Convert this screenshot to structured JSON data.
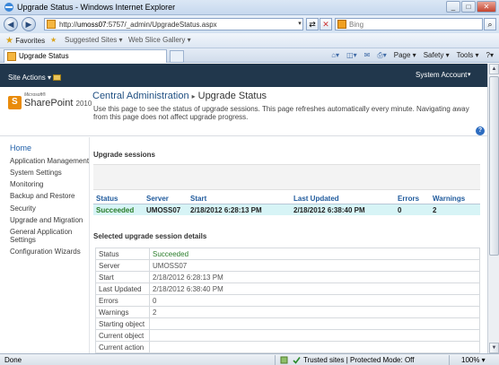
{
  "window": {
    "title": "Upgrade Status - Windows Internet Explorer",
    "minimize": "_",
    "maximize": "□",
    "close": "✕"
  },
  "addressbar": {
    "url_prefix": "http://",
    "url_host": "umoss07",
    "url_rest": ":5757/_admin/UpgradeStatus.aspx",
    "search_placeholder": "Bing"
  },
  "favorites": {
    "favorites_label": "Favorites",
    "suggested_sites": "Suggested Sites ▾",
    "web_slice_gallery": "Web Slice Gallery ▾"
  },
  "tab": {
    "label": "Upgrade Status"
  },
  "commandbar": {
    "page": "Page ▾",
    "safety": "Safety ▾",
    "tools": "Tools ▾",
    "help": "?▾"
  },
  "sharepoint": {
    "site_actions": "Site Actions ▾",
    "system_account": "System Account",
    "logo_ms": "Microsoft®",
    "logo_word": "SharePoint",
    "logo_year": "2010",
    "breadcrumb_root": "Central Administration",
    "breadcrumb_sep": "▸",
    "breadcrumb_current": "Upgrade Status",
    "page_description": "Use this page to see the status of upgrade sessions. This page refreshes automatically every minute. Navigating away from this page does not affect upgrade progress."
  },
  "leftnav": {
    "items": [
      {
        "label": "Home"
      },
      {
        "label": "Application Management"
      },
      {
        "label": "System Settings"
      },
      {
        "label": "Monitoring"
      },
      {
        "label": "Backup and Restore"
      },
      {
        "label": "Security"
      },
      {
        "label": "Upgrade and Migration"
      },
      {
        "label": "General Application Settings"
      },
      {
        "label": "Configuration Wizards"
      }
    ]
  },
  "sessions": {
    "heading": "Upgrade sessions",
    "columns": [
      "Status",
      "Server",
      "Start",
      "Last Updated",
      "Errors",
      "Warnings"
    ],
    "rows": [
      {
        "status": "Succeeded",
        "server": "UMOSS07",
        "start": "2/18/2012 6:28:13 PM",
        "last_updated": "2/18/2012 6:38:40 PM",
        "errors": "0",
        "warnings": "2"
      }
    ]
  },
  "details": {
    "heading": "Selected upgrade session details",
    "rows": [
      {
        "key": "Status",
        "value": "Succeeded"
      },
      {
        "key": "Server",
        "value": "UMOSS07"
      },
      {
        "key": "Start",
        "value": "2/18/2012 6:28:13 PM"
      },
      {
        "key": "Last Updated",
        "value": "2/18/2012 6:38:40 PM"
      },
      {
        "key": "Errors",
        "value": "0"
      },
      {
        "key": "Warnings",
        "value": "2"
      },
      {
        "key": "Starting object",
        "value": ""
      },
      {
        "key": "Current object",
        "value": ""
      },
      {
        "key": "Current action",
        "value": ""
      }
    ]
  },
  "statusbar": {
    "done": "Done",
    "zone": "Trusted sites | Protected Mode: Off",
    "zoom": "100%  ▾"
  },
  "colors": {
    "ribbon": "#21374c",
    "accent_link": "#1f5a9c",
    "succeeded": "#2a7d2a",
    "session_row": "#d7f4f6"
  }
}
